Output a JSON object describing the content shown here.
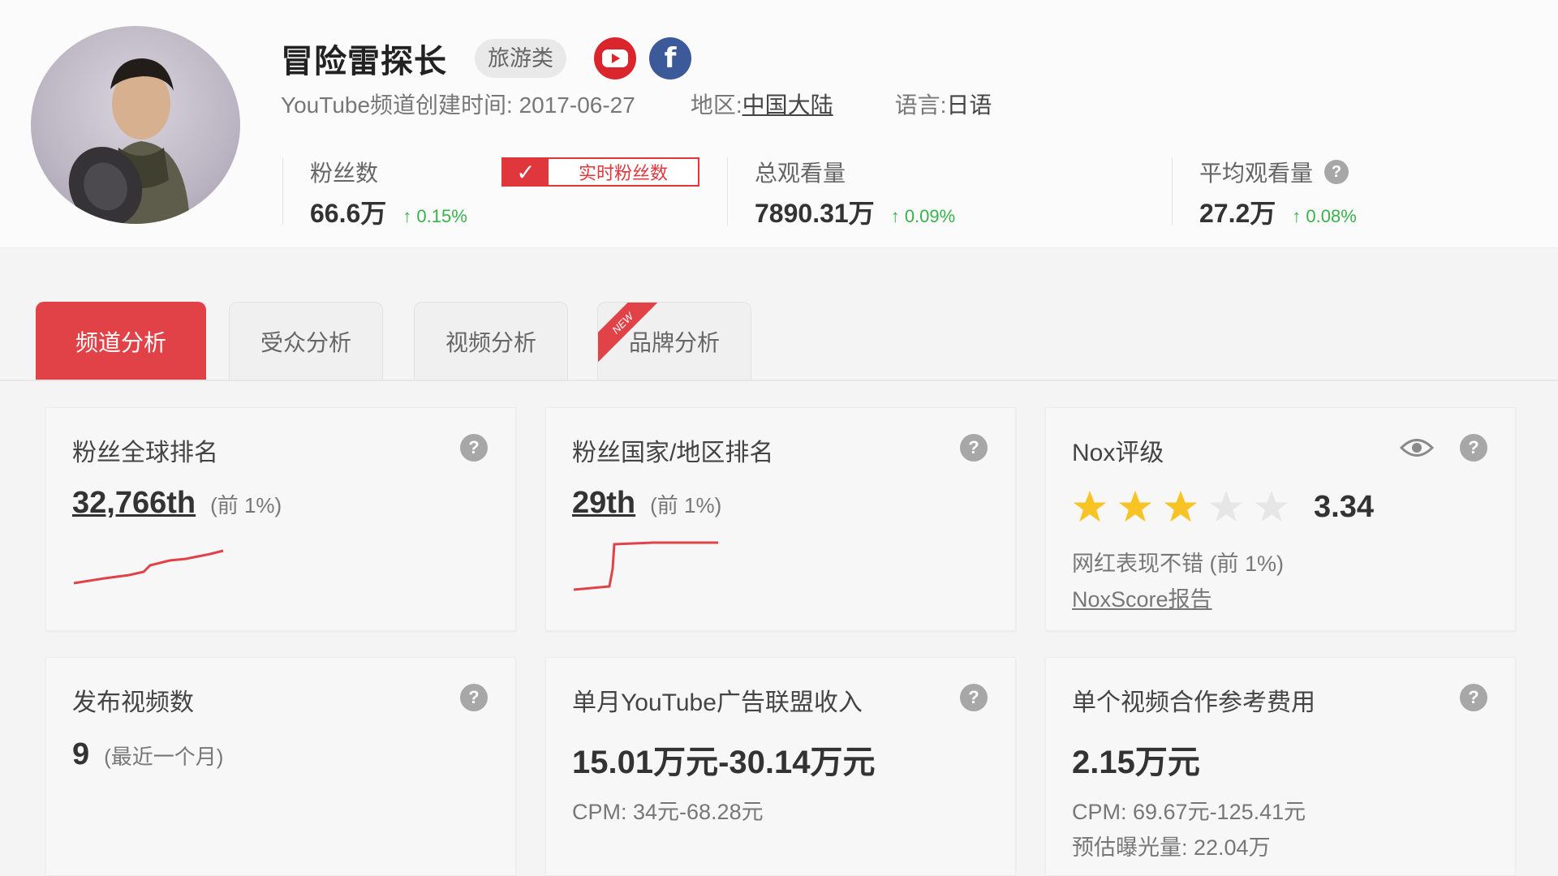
{
  "profile": {
    "channel_name": "冒险雷探长",
    "category": "旅游类",
    "platforms": [
      "youtube-icon",
      "facebook-icon"
    ],
    "created_label": "YouTube频道创建时间: 2017-06-27",
    "region_label": "地区:",
    "region_value": "中国大陆",
    "language_label": "语言:",
    "language_value": "日语"
  },
  "stats": {
    "followers": {
      "label": "粉丝数",
      "value": "66.6万",
      "change": "0.15%"
    },
    "realtime_button": "实时粉丝数",
    "total_views": {
      "label": "总观看量",
      "value": "7890.31万",
      "change": "0.09%"
    },
    "avg_views": {
      "label": "平均观看量",
      "value": "27.2万",
      "change": "0.08%"
    },
    "up_arrow": "↑",
    "help": "?"
  },
  "tabs": [
    {
      "label": "频道分析",
      "active": true
    },
    {
      "label": "受众分析",
      "active": false
    },
    {
      "label": "视频分析",
      "active": false
    },
    {
      "label": "品牌分析",
      "active": false,
      "badge": "NEW"
    }
  ],
  "cards": {
    "global_rank": {
      "title": "粉丝全球排名",
      "value": "32,766th",
      "note": "(前 1%)"
    },
    "country_rank": {
      "title": "粉丝国家/地区排名",
      "value": "29th",
      "note": "(前 1%)"
    },
    "nox": {
      "title": "Nox评级",
      "rating": 3.34,
      "score_text": "3.34",
      "stars_filled": 3,
      "stars_total": 5,
      "desc": "网红表现不错 (前 1%)",
      "link": "NoxScore报告"
    },
    "videos": {
      "title": "发布视频数",
      "value": "9",
      "note": "(最近一个月)"
    },
    "ad_income": {
      "title": "单月YouTube广告联盟收入",
      "value": "15.01万元-30.14万元",
      "cpm": "CPM: 34元-68.28元"
    },
    "collab_fee": {
      "title": "单个视频合作参考费用",
      "value": "2.15万元",
      "cpm": "CPM: 69.67元-125.41元",
      "exposure": "预估曝光量: 22.04万"
    }
  },
  "colors": {
    "accent": "#e14247",
    "positive": "#38b24a",
    "star": "#f7c325",
    "star_empty": "#e6e6e6"
  }
}
